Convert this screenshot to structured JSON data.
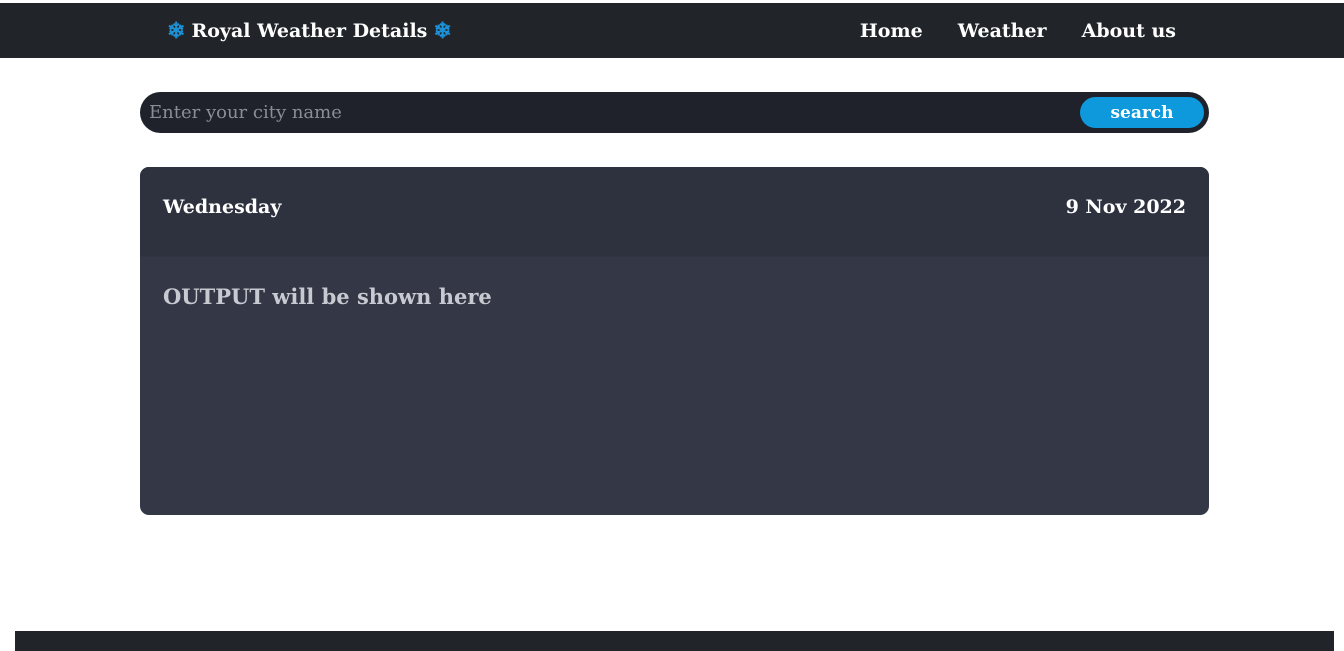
{
  "header": {
    "brand": {
      "icon_left": "snowflake-icon",
      "title": "Royal Weather Details",
      "icon_right": "snowflake-icon",
      "icon_color": "#1e90d6"
    },
    "nav": [
      {
        "label": "Home"
      },
      {
        "label": "Weather"
      },
      {
        "label": "About us"
      }
    ]
  },
  "search": {
    "value": "",
    "placeholder": "Enter your city name",
    "button_label": "search",
    "button_color": "#0d99db"
  },
  "weather_card": {
    "day": "Wednesday",
    "date": "9 Nov 2022",
    "output_text": "OUTPUT will be shown here"
  },
  "colors": {
    "topbar": "#212529",
    "search_bg": "#1f212b",
    "card_bg": "#333746",
    "card_header_bg": "#2e323f"
  }
}
